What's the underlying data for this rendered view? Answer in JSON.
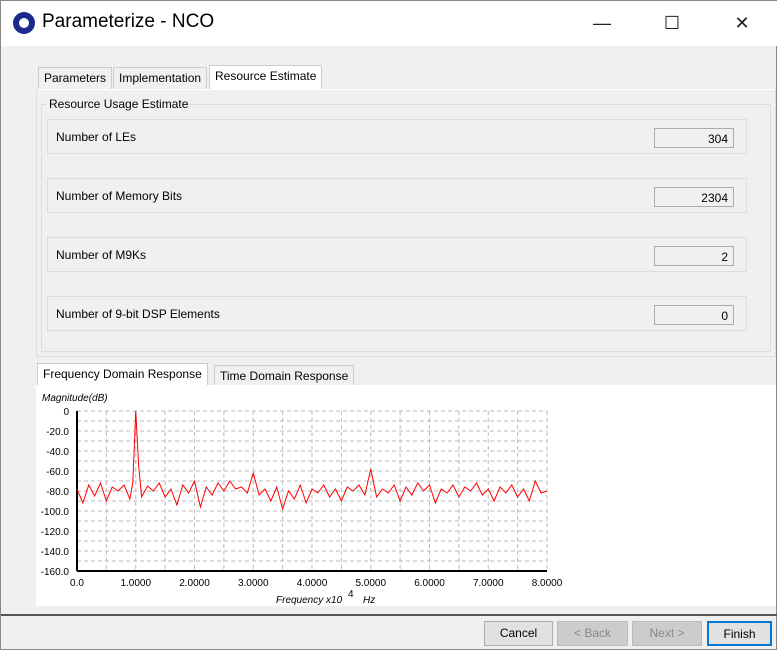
{
  "window": {
    "title": "Parameterize - NCO",
    "minimize": "—",
    "maximize": "☐",
    "close": "✕"
  },
  "tabs": [
    {
      "label": "Parameters"
    },
    {
      "label": "Implementation"
    },
    {
      "label": "Resource Estimate",
      "active": true
    }
  ],
  "group_title": "Resource Usage Estimate",
  "rows": [
    {
      "label": "Number of LEs",
      "value": "304"
    },
    {
      "label": "Number of Memory Bits",
      "value": "2304"
    },
    {
      "label": "Number of M9Ks",
      "value": "2"
    },
    {
      "label": "Number of 9-bit DSP Elements",
      "value": "0"
    }
  ],
  "response_tabs": [
    {
      "label": "Frequency Domain Response",
      "active": true
    },
    {
      "label": "Time Domain Response"
    }
  ],
  "buttons": {
    "cancel": "Cancel",
    "back": "< Back",
    "next": "Next >",
    "finish": "Finish"
  },
  "chart_data": {
    "type": "line",
    "ylabel": "Magnitude(dB)",
    "xlabel": "Frequency x10",
    "xlabel_exp": "4",
    "xlabel_unit": "Hz",
    "ylim": [
      -160,
      0
    ],
    "xlim": [
      0,
      8
    ],
    "grid": true,
    "color": "#ff0000",
    "yticks": [
      "0",
      "-20.0",
      "-40.0",
      "-60.0",
      "-80.0",
      "-100.0",
      "-120.0",
      "-140.0",
      "-160.0"
    ],
    "xticks": [
      "0.0",
      "1.0000",
      "2.0000",
      "3.0000",
      "4.0000",
      "5.0000",
      "6.0000",
      "7.0000",
      "8.0000"
    ],
    "x": [
      0,
      0.1,
      0.2,
      0.3,
      0.4,
      0.5,
      0.6,
      0.7,
      0.8,
      0.9,
      0.95,
      1.0,
      1.05,
      1.1,
      1.2,
      1.3,
      1.4,
      1.5,
      1.6,
      1.7,
      1.8,
      1.9,
      2.0,
      2.1,
      2.2,
      2.3,
      2.4,
      2.5,
      2.6,
      2.7,
      2.8,
      2.9,
      3.0,
      3.1,
      3.2,
      3.3,
      3.4,
      3.5,
      3.6,
      3.7,
      3.8,
      3.9,
      4.0,
      4.1,
      4.2,
      4.3,
      4.4,
      4.5,
      4.6,
      4.7,
      4.8,
      4.9,
      5.0,
      5.1,
      5.2,
      5.3,
      5.4,
      5.5,
      5.6,
      5.7,
      5.8,
      5.9,
      6.0,
      6.1,
      6.2,
      6.3,
      6.4,
      6.5,
      6.6,
      6.7,
      6.8,
      6.9,
      7.0,
      7.1,
      7.2,
      7.3,
      7.4,
      7.5,
      7.6,
      7.7,
      7.8,
      7.9,
      8.0
    ],
    "y": [
      -78,
      -92,
      -74,
      -85,
      -72,
      -90,
      -76,
      -80,
      -74,
      -88,
      -72,
      0,
      -55,
      -86,
      -75,
      -80,
      -72,
      -86,
      -78,
      -94,
      -74,
      -82,
      -70,
      -96,
      -76,
      -84,
      -72,
      -80,
      -70,
      -78,
      -76,
      -82,
      -62,
      -84,
      -78,
      -90,
      -76,
      -98,
      -80,
      -88,
      -74,
      -92,
      -78,
      -82,
      -74,
      -86,
      -78,
      -90,
      -76,
      -80,
      -74,
      -84,
      -58,
      -86,
      -78,
      -82,
      -74,
      -90,
      -76,
      -84,
      -72,
      -80,
      -74,
      -92,
      -78,
      -82,
      -74,
      -86,
      -76,
      -80,
      -72,
      -84,
      -78,
      -90,
      -76,
      -82,
      -74,
      -86,
      -78,
      -90,
      -70,
      -82,
      -80
    ]
  }
}
